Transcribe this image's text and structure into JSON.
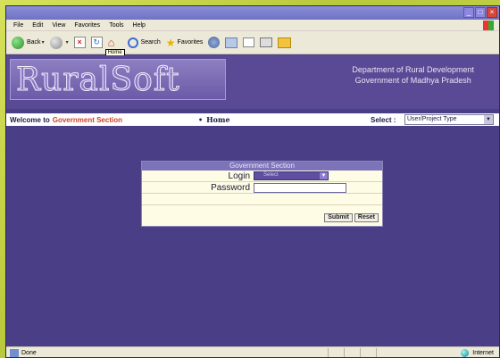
{
  "menu": {
    "items": [
      "File",
      "Edit",
      "View",
      "Favorites",
      "Tools",
      "Help"
    ]
  },
  "toolbar": {
    "back_label": "Back",
    "search_label": "Search",
    "favorites_label": "Favorites",
    "home_tooltip": "Home"
  },
  "banner": {
    "logo_text": "RuralSoft",
    "dept_line1": "Department of Rural Development",
    "dept_line2": "Government of Madhya Pradesh"
  },
  "nav": {
    "welcome_prefix": "Welcome to",
    "welcome_section": "Government Section",
    "home_link": "Home",
    "select_label": "Select :",
    "select_value": "User/Project Type"
  },
  "login": {
    "title": "Government Section",
    "login_label": "Login",
    "login_value": "Select",
    "password_label": "Password",
    "password_value": "",
    "submit_label": "Submit",
    "reset_label": "Reset"
  },
  "status": {
    "left_text": "Done",
    "zone_text": "Internet"
  },
  "colors": {
    "page_bg": "#4a3f86",
    "accent_red": "#d0402a",
    "login_panel_bg": "#fffce5"
  }
}
